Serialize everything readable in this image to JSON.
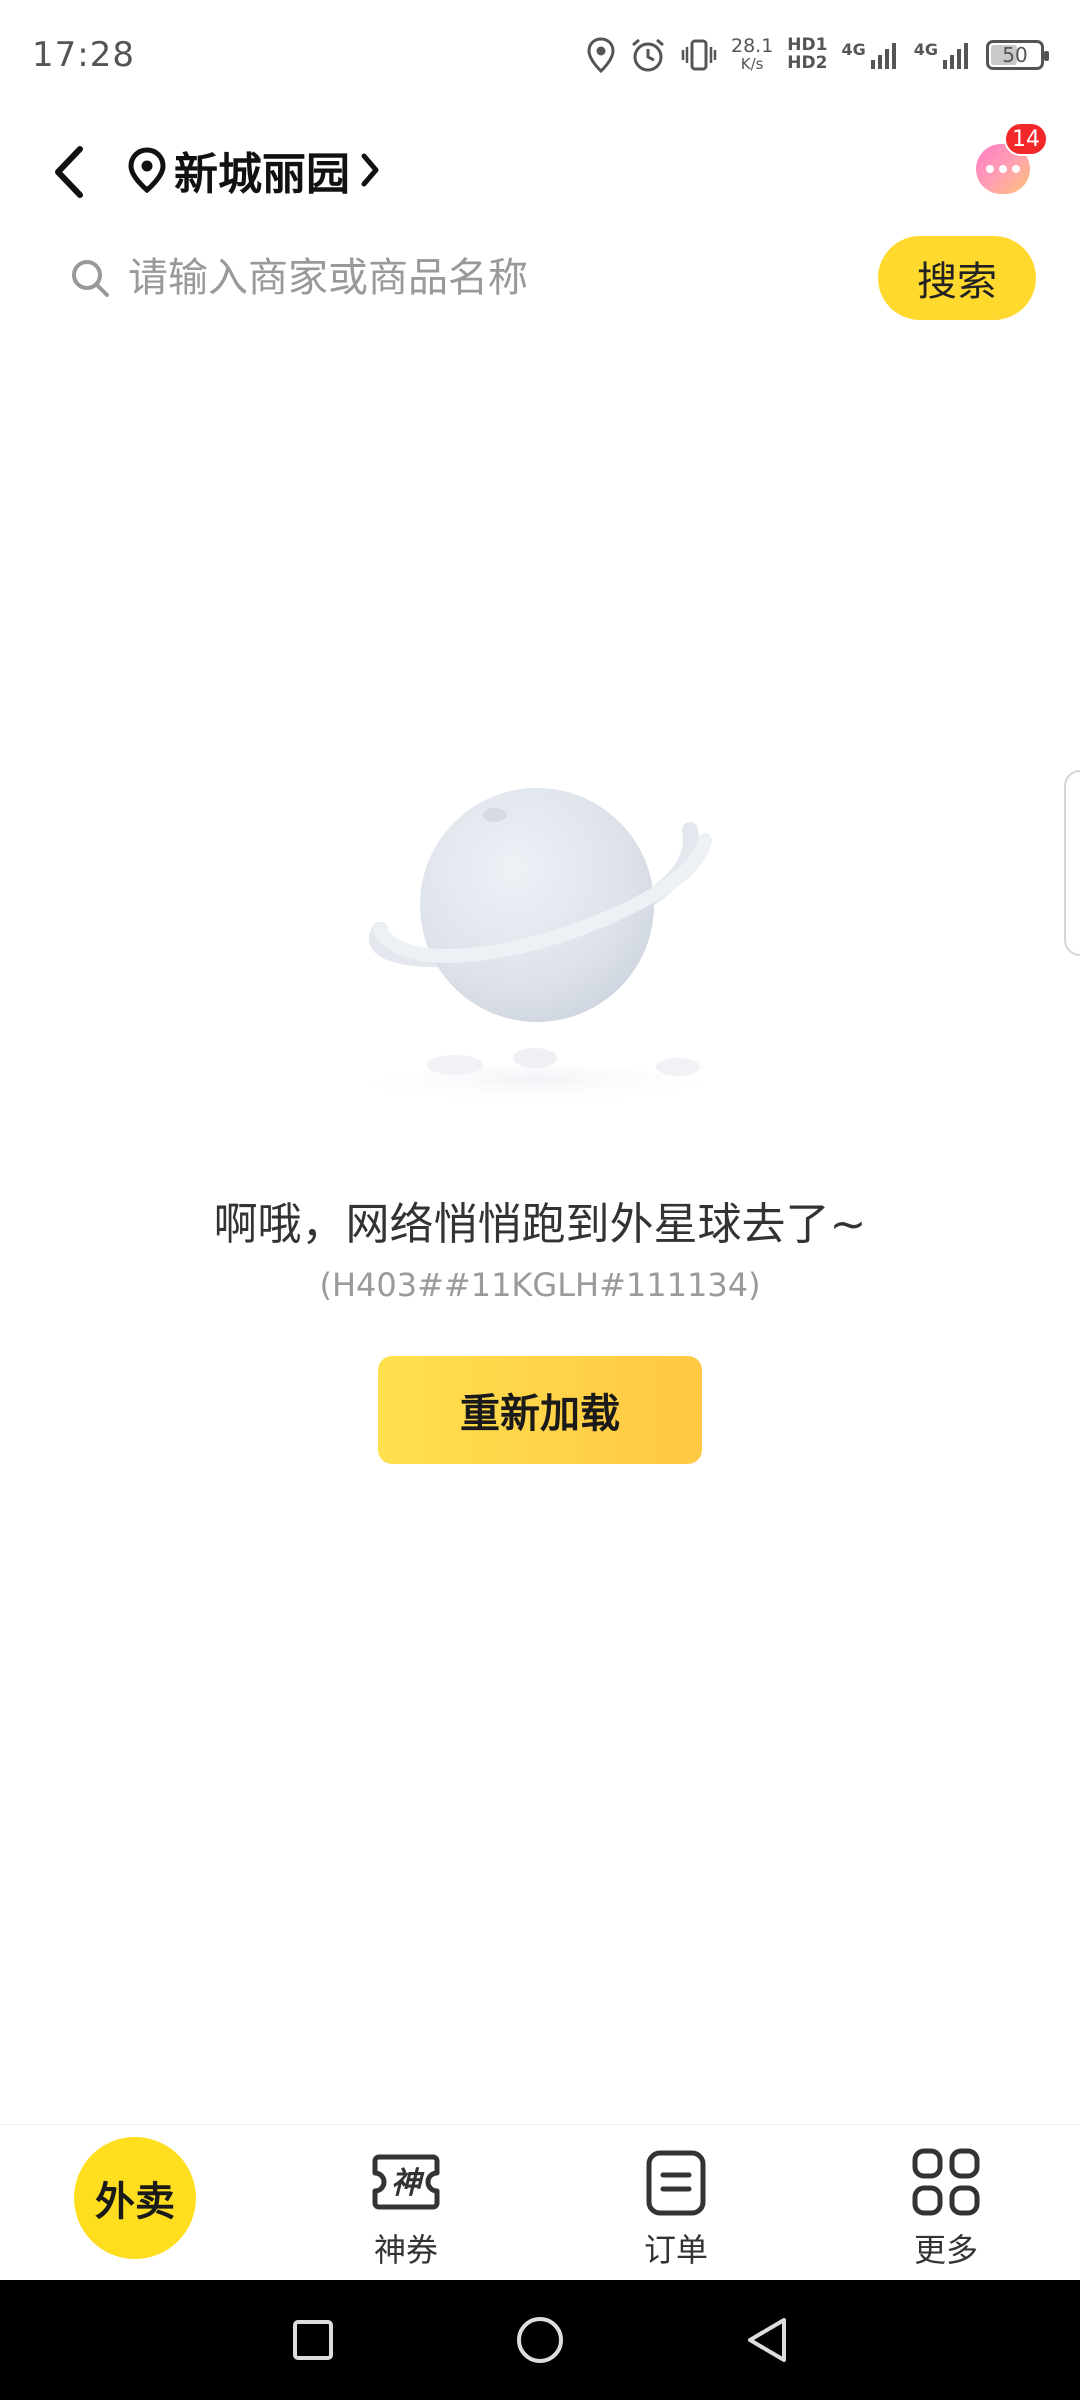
{
  "status_bar": {
    "time": "17:28",
    "net_speed": "28.1",
    "net_unit": "K/s",
    "hd1": "HD1",
    "hd2": "HD2",
    "sim1": "4G",
    "sim2": "4G",
    "battery": "50"
  },
  "header": {
    "location": "新城丽园",
    "message_badge": "14"
  },
  "search": {
    "placeholder": "请输入商家或商品名称",
    "button_label": "搜索"
  },
  "empty_state": {
    "title": "啊哦，网络悄悄跑到外星球去了~",
    "error_code": "(H403##11KGLH#111134)",
    "reload_label": "重新加载"
  },
  "tabs": [
    {
      "label": "外卖",
      "icon": "takeout-icon",
      "active": true
    },
    {
      "label": "神券",
      "icon": "coupon-icon",
      "glyph": "神"
    },
    {
      "label": "订单",
      "icon": "order-icon"
    },
    {
      "label": "更多",
      "icon": "more-grid-icon"
    }
  ],
  "colors": {
    "accent": "#ffd92e",
    "badge": "#f2282b",
    "nav_bar": "#000000"
  }
}
